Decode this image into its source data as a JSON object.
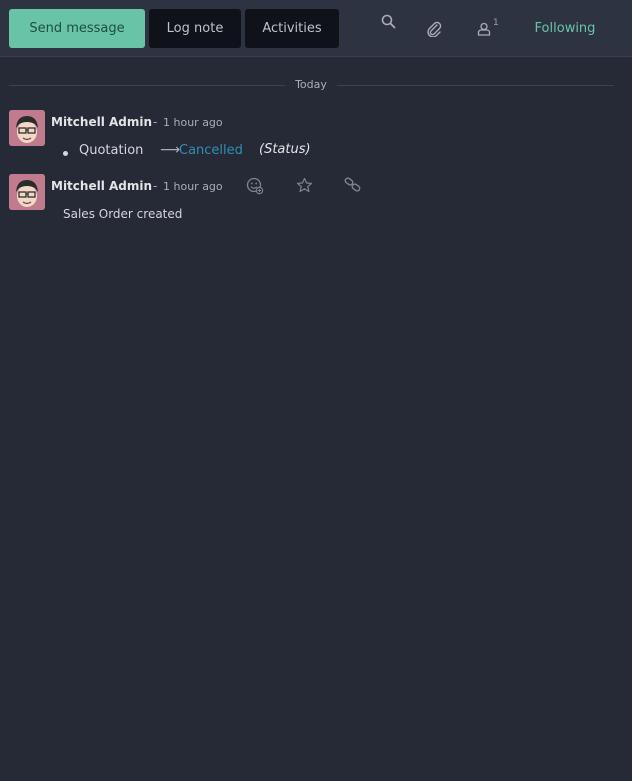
{
  "toolbar": {
    "send_message": "Send message",
    "log_note": "Log note",
    "activities": "Activities",
    "search_icon": "search-icon",
    "attachment_icon": "paperclip-icon",
    "followers_icon": "user-icon",
    "followers_count": "1",
    "following": "Following"
  },
  "divider": {
    "label": "Today"
  },
  "messages": [
    {
      "author": "Mitchell Admin",
      "separator": "-",
      "time": "1 hour ago",
      "tracking": {
        "field": "Quotation",
        "new_value": "Cancelled",
        "field_name": "(Status)"
      }
    },
    {
      "author": "Mitchell Admin",
      "separator": "-",
      "time": "1 hour ago",
      "body": "Sales Order created",
      "actions": [
        "add-reaction-icon",
        "star-icon",
        "link-icon"
      ]
    }
  ],
  "colors": {
    "accent": "#69c3a6",
    "link": "#2f8fb0",
    "background": "#262a36"
  }
}
